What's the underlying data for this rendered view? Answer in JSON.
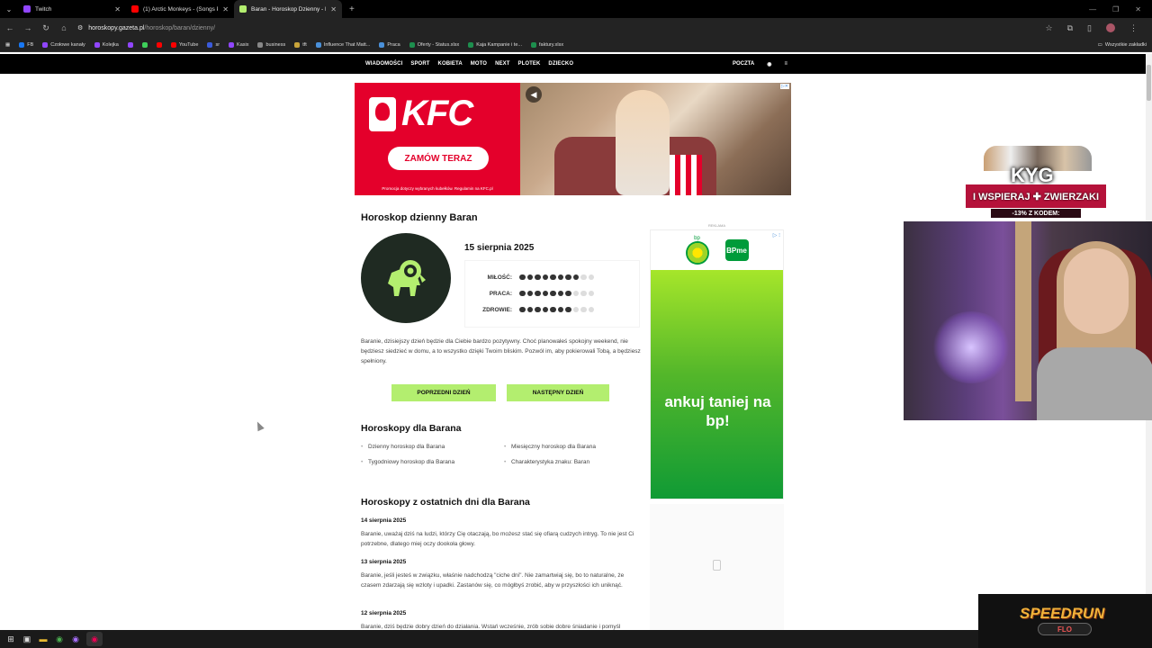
{
  "browser": {
    "tabs": [
      {
        "title": "Twitch",
        "color": "#9146ff",
        "active": false
      },
      {
        "title": "(1) Arctic Monkeys - (Songs Pl",
        "color": "#ff0000",
        "active": false
      },
      {
        "title": "Baran - Horoskop Dzienny - Ho",
        "color": "#b3ee6f",
        "active": true
      }
    ],
    "url_host": "horoskopy.gazeta.pl",
    "url_path": "/horoskop/baran/dzienny/",
    "bookmarks": [
      {
        "label": "FB",
        "color": "#1877f2"
      },
      {
        "label": "Czołowe kanały",
        "color": "#9146ff"
      },
      {
        "label": "Kolejka",
        "color": "#9146ff"
      },
      {
        "label": "",
        "color": "#9146ff"
      },
      {
        "label": "",
        "color": "#3ecf5a"
      },
      {
        "label": "",
        "color": "#ff0000"
      },
      {
        "label": "YouTube",
        "color": "#ff0000"
      },
      {
        "label": "sr",
        "color": "#3b5bdb"
      },
      {
        "label": "Kasix",
        "color": "#9146ff"
      },
      {
        "label": "business",
        "color": "#888888"
      },
      {
        "label": "tft",
        "color": "#c9a43a"
      },
      {
        "label": "Influence That Matt...",
        "color": "#4a90d9"
      },
      {
        "label": "Praca",
        "color": "#4a90d9"
      },
      {
        "label": "Oferty - Status.xlsx",
        "color": "#1d8f4e"
      },
      {
        "label": "Kaja Kampanie i te...",
        "color": "#1d8f4e"
      },
      {
        "label": "faktury.xlsx",
        "color": "#1d8f4e"
      }
    ],
    "all_bookmarks": "Wszystkie zakładki"
  },
  "sitenav": {
    "links": [
      "WIADOMOŚCI",
      "SPORT",
      "KOBIETA",
      "MOTO",
      "NEXT",
      "PLOTEK",
      "DZIECKO"
    ],
    "poczta": "POCZTA"
  },
  "kfc_ad": {
    "brand": "KFC",
    "cta": "ZAMÓW TERAZ",
    "footnote": "Promocja dotyczy wybranych kubełków. Regulamin na KFC.pl"
  },
  "horoscope": {
    "title": "Horoskop dzienny Baran",
    "date": "15 sierpnia 2025",
    "ratings": [
      {
        "label": "MIŁOŚĆ:",
        "value": 8,
        "max": 10
      },
      {
        "label": "PRACA:",
        "value": 7,
        "max": 10
      },
      {
        "label": "ZDROWIE:",
        "value": 7,
        "max": 10
      }
    ],
    "description": "Baranie, dzisiejszy dzień będzie dla Ciebie bardzo pozytywny. Choć planowałeś spokojny weekend, nie będziesz siedzieć w domu, a to wszystko dzięki Twoim bliskim. Pozwól im, aby pokierowali Tobą, a będziesz spełniony.",
    "prev_button": "POPRZEDNI DZIEŃ",
    "next_button": "NASTĘPNY DZIEŃ"
  },
  "more": {
    "title": "Horoskopy dla Barana",
    "links": [
      "Dzienny horoskop dla Barana",
      "Miesięczny horoskop dla Barana",
      "Tygodniowy horoskop dla Barana",
      "Charakterystyka znaku: Baran"
    ]
  },
  "recent": {
    "title": "Horoskopy z ostatnich dni dla Barana",
    "entries": [
      {
        "date": "14 sierpnia 2025",
        "text": "Baranie, uważaj dziś na ludzi, którzy Cię otaczają, bo możesz stać się ofiarą cudzych intryg. To nie jest Ci potrzebne, dlatego miej oczy dookoła głowy."
      },
      {
        "date": "13 sierpnia 2025",
        "text": "Baranie, jeśli jesteś w związku, właśnie nadchodzą \"ciche dni\". Nie zamartwiaj się, bo to naturalne, że czasem zdarzają się wzloty i upadki. Zastanów się, co mógłbyś zrobić, aby w przyszłości ich uniknąć."
      },
      {
        "date": "12 sierpnia 2025",
        "text": "Baranie, dziś będzie dobry dzień do działania. Wstań wcześnie, zrób sobie dobre śniadanie i pomyśl"
      }
    ]
  },
  "bp_ad": {
    "label": "REKLAMA",
    "brand": "bp",
    "app": "BPme",
    "slogan": "ankuj taniej na bp!"
  },
  "overlays": {
    "kyg_logo": "KYG",
    "kyg_banner": "I WSPIERAJ ✚ ZWIERZAKI",
    "kyg_code": "-13% Z KODEM:",
    "speedrun": "SPEEDRUN",
    "speedrun_sub": "FLO"
  }
}
